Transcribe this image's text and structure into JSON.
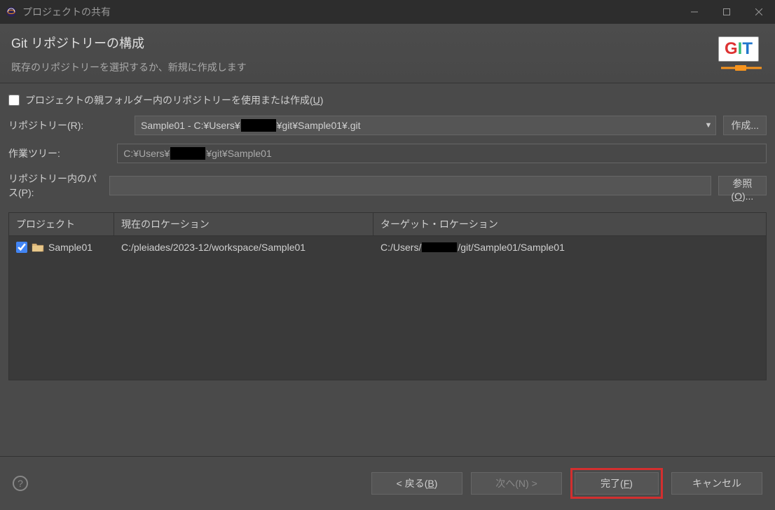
{
  "titlebar": {
    "title": "プロジェクトの共有"
  },
  "header": {
    "heading": "Git リポジトリーの構成",
    "sub": "既存のリポジトリーを選択するか、新規に作成します",
    "git_logo": "GIT"
  },
  "form": {
    "checkbox_label_a": "プロジェクトの親フォルダー内のリポジトリーを使用または作成(",
    "checkbox_label_u": "U",
    "checkbox_label_b": ")",
    "checkbox_checked": false,
    "repo_label": "リポジトリー(R):",
    "repo_value_a": "Sample01 - C:¥Users¥",
    "repo_value_b": "¥git¥Sample01¥.git",
    "create_label": "作成...",
    "worktree_label": "作業ツリー:",
    "worktree_value_a": "C:¥Users¥",
    "worktree_value_b": "¥git¥Sample01",
    "path_label": "リポジトリー内のパス(P):",
    "path_value": "",
    "browse_label_a": "参照(",
    "browse_label_u": "O",
    "browse_label_b": ")..."
  },
  "table": {
    "col1": "プロジェクト",
    "col2": "現在のロケーション",
    "col3": "ターゲット・ロケーション",
    "rows": [
      {
        "checked": true,
        "name": "Sample01",
        "current": "C:/pleiades/2023-12/workspace/Sample01",
        "target_a": "C:/Users/",
        "target_b": "/git/Sample01/Sample01"
      }
    ]
  },
  "footer": {
    "back_a": "< 戻る(",
    "back_u": "B",
    "back_b": ")",
    "next": "次へ(N) >",
    "finish_a": "完了(",
    "finish_u": "F",
    "finish_b": ")",
    "cancel": "キャンセル"
  }
}
